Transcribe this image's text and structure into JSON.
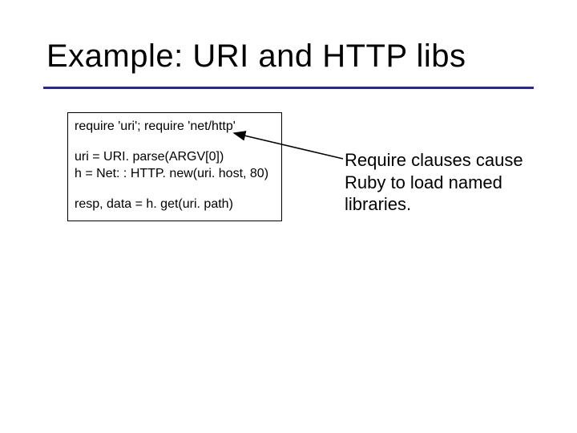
{
  "title": "Example: URI and HTTP libs",
  "code": {
    "line1": "require 'uri'; require  'net/http'",
    "line2": "uri = URI. parse(ARGV[0])",
    "line3": "h = Net: : HTTP. new(uri. host, 80)",
    "line4": "resp, data = h. get(uri. path)"
  },
  "annotation": "Require clauses cause Ruby to load named libraries."
}
